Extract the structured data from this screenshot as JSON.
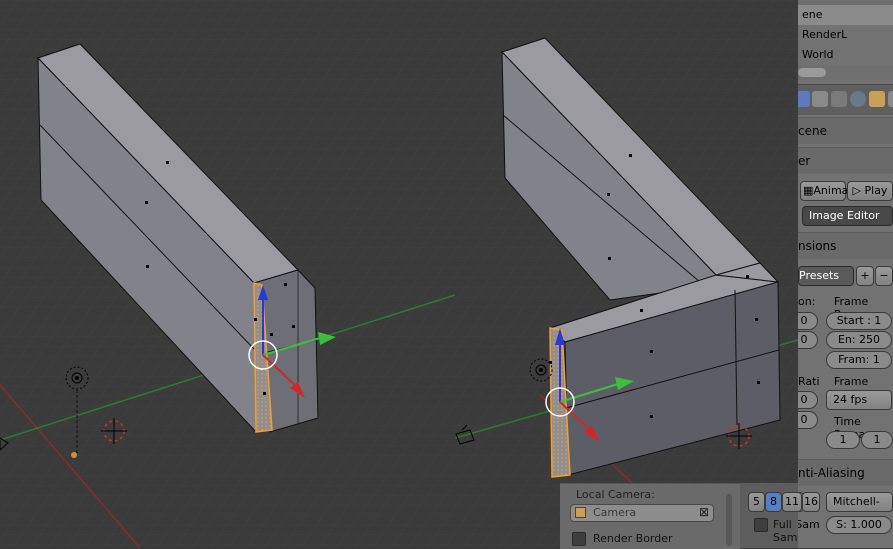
{
  "outliner": {
    "rows": [
      "ene",
      "RenderL",
      "World"
    ]
  },
  "properties": {
    "scene_label": "cene",
    "render_label": "er",
    "anim_button": "Anima",
    "play_button": "Play",
    "display_select": "Image Editor",
    "dimensions_header": "nsions",
    "presets_select": "Presets",
    "resolution_label": "on:",
    "res_x": "0",
    "res_y": "0",
    "frame_range_label": "Frame Rang",
    "start_field": "Start : 1",
    "end_field": "En: 250",
    "frame_step_field": "Fram: 1",
    "aspect_label": "Rati",
    "aspect_x": "0",
    "aspect_y": "0",
    "frame_rate_label": "Frame Rate",
    "fps_select": "24 fps",
    "time_remap_label": "Time Rema",
    "remap_old": "1",
    "remap_new": "1",
    "anti_aliasing_header": "nti-Aliasing",
    "aa_samples": [
      "5",
      "8",
      "11",
      "16"
    ],
    "aa_selected": "8",
    "filter_select": "Mitchell-",
    "full_sample_label": "Full Sam",
    "filter_size": "S: 1.000"
  },
  "tool_shelf": {
    "local_camera_label": "Local Camera:",
    "camera_field": "Camera",
    "render_border_label": "Render Border"
  },
  "colors": {
    "viewport_bg": "#3b3b3b",
    "mesh_face": "#8e8e94",
    "mesh_dark": "#5f6068",
    "selection": "#f0a030",
    "x_axis": "#c83232",
    "y_axis": "#3c9e3c",
    "panel_bg": "#727272"
  }
}
